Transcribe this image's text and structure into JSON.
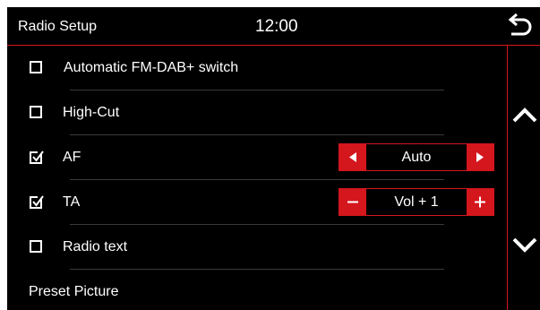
{
  "header": {
    "title": "Radio Setup",
    "time": "12:00"
  },
  "rows": [
    {
      "label": "Automatic FM-DAB+ switch",
      "checked": false
    },
    {
      "label": "High-Cut",
      "checked": false
    },
    {
      "label": "AF",
      "checked": true,
      "value": "Auto"
    },
    {
      "label": "TA",
      "checked": true,
      "value": "Vol + 1"
    },
    {
      "label": "Radio text",
      "checked": false
    },
    {
      "label": "Preset Picture"
    }
  ],
  "colors": {
    "accent": "#d4161d",
    "background": "#000000",
    "text": "#ffffff"
  },
  "icons": {
    "back": "back-arrow-icon",
    "scroll_up": "chevron-up-icon",
    "scroll_down": "chevron-down-icon",
    "prev": "triangle-left-icon",
    "next": "triangle-right-icon",
    "decrease": "minus-icon",
    "increase": "plus-icon"
  }
}
